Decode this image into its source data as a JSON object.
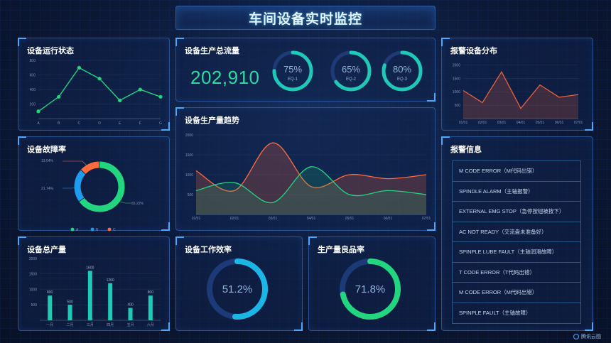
{
  "header": {
    "title": "车间设备实时监控"
  },
  "panels": {
    "status": {
      "title": "设备运行状态"
    },
    "total_flow": {
      "title": "设备生产总流量"
    },
    "alarm_dist": {
      "title": "报警设备分布"
    },
    "failure": {
      "title": "设备故障率"
    },
    "trend": {
      "title": "设备生产量趋势"
    },
    "alarm_info": {
      "title": "报警信息"
    },
    "total_output": {
      "title": "设备总产量"
    },
    "efficiency": {
      "title": "设备工作效率"
    },
    "yield": {
      "title": "生产量良品率"
    }
  },
  "total_flow_value": "202,910",
  "gauges": [
    {
      "pct": "75%",
      "label": "EQ-1",
      "value": 0.75
    },
    {
      "pct": "65%",
      "label": "EQ-2",
      "value": 0.65
    },
    {
      "pct": "80%",
      "label": "EQ-3",
      "value": 0.8
    }
  ],
  "efficiency_pct": "51.2%",
  "yield_pct": "71.8%",
  "alarms": [
    "M CODE ERROR（M代码出错）",
    "SPINDLE ALARM（主轴报警）",
    "EXTERNAL EMG STOP（急停按钮被按下）",
    "AC NOT READY（交流盘未准备好）",
    "SPINPLE LUBE FAULT（主轴润滑故障）",
    "T CODE ERROR（T代码出错）",
    "M CODE ERROR（M代码出错）",
    "SPINPLE FAULT（主轴故障）"
  ],
  "logo_text": "腾讯云图",
  "colors": {
    "green": "#22d67f",
    "teal": "#1fc9b8",
    "blue": "#1e9cf0",
    "orange": "#ff6b3d",
    "red_orange": "#e9603a"
  },
  "chart_data": [
    {
      "id": "status",
      "type": "line",
      "categories": [
        "A",
        "B",
        "C",
        "D",
        "E",
        "F",
        "G"
      ],
      "values": [
        100,
        300,
        700,
        550,
        250,
        400,
        300
      ],
      "yticks": [
        "200",
        "400",
        "600",
        "800"
      ],
      "ylim": [
        0,
        850
      ]
    },
    {
      "id": "failure",
      "type": "pie",
      "donut": true,
      "categories": [
        "A",
        "B",
        "C"
      ],
      "values": [
        65.22,
        21.74,
        13.04
      ],
      "labels": [
        "65.22%",
        "21.74%",
        "13.04%"
      ]
    },
    {
      "id": "alarm_dist",
      "type": "area",
      "categories": [
        "01/01",
        "02/01",
        "03/01",
        "04/01",
        "05/01",
        "06/01",
        "07/01"
      ],
      "values": [
        1050,
        600,
        1750,
        380,
        1260,
        800,
        900
      ],
      "yticks": [
        "500",
        "1000",
        "1500",
        "2000"
      ],
      "ylim": [
        0,
        2100
      ]
    },
    {
      "id": "trend",
      "type": "area",
      "categories": [
        "01/01",
        "02/01",
        "03/01",
        "04/01",
        "05/01",
        "06/01",
        "07/01"
      ],
      "series": [
        {
          "values": [
            1100,
            600,
            1800,
            700,
            1000,
            900,
            1000
          ]
        },
        {
          "values": [
            600,
            800,
            300,
            1200,
            500,
            600,
            500
          ]
        }
      ],
      "yticks": [
        "500",
        "1000",
        "1500",
        "2000"
      ],
      "ylim": [
        0,
        2000
      ]
    },
    {
      "id": "total_output",
      "type": "bar",
      "categories": [
        "一月",
        "二月",
        "三月",
        "四月",
        "五月",
        "六月"
      ],
      "values": [
        800,
        500,
        1600,
        1200,
        400,
        800
      ],
      "labels": [
        "800",
        "500",
        "1600",
        "1200",
        "400",
        "800"
      ],
      "yticks": [
        "500",
        "1000",
        "1500",
        "2000"
      ],
      "ylim": [
        0,
        2000
      ]
    },
    {
      "id": "efficiency",
      "type": "pie",
      "donut": true,
      "values": [
        51.2
      ]
    },
    {
      "id": "yield",
      "type": "pie",
      "donut": true,
      "values": [
        71.8
      ]
    }
  ]
}
